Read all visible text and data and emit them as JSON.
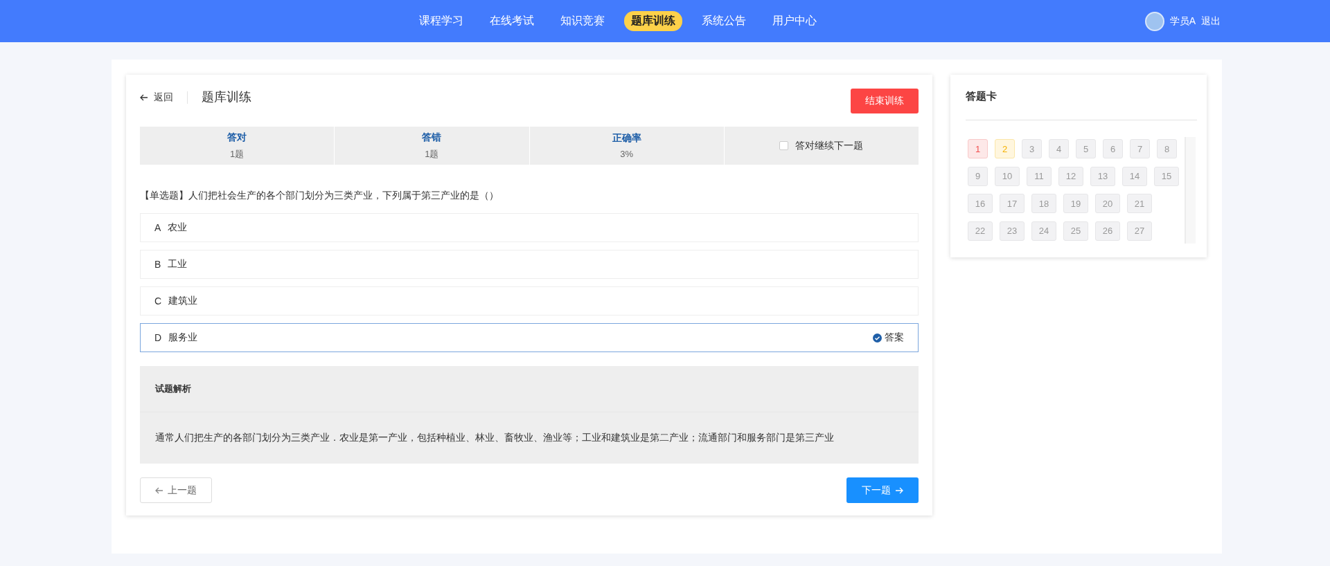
{
  "nav": {
    "items": [
      {
        "label": "课程学习",
        "selected": false
      },
      {
        "label": "在线考试",
        "selected": false
      },
      {
        "label": "知识竞赛",
        "selected": false
      },
      {
        "label": "题库训练",
        "selected": true
      },
      {
        "label": "系统公告",
        "selected": false
      },
      {
        "label": "用户中心",
        "selected": false
      }
    ],
    "user": "学员A",
    "logout": "退出"
  },
  "practice": {
    "back": "返回",
    "title": "题库训练",
    "end_button": "结束训练",
    "stats": [
      {
        "label": "答对",
        "value": "1题"
      },
      {
        "label": "答错",
        "value": "1题"
      },
      {
        "label": "正确率",
        "value": "3%"
      }
    ],
    "auto_next": {
      "label": "答对继续下一题",
      "checked": false
    },
    "question": "【单选题】人们把社会生产的各个部门划分为三类产业，下列属于第三产业的是（）",
    "options": [
      {
        "letter": "A",
        "text": "农业",
        "correct": false
      },
      {
        "letter": "B",
        "text": "工业",
        "correct": false
      },
      {
        "letter": "C",
        "text": "建筑业",
        "correct": false
      },
      {
        "letter": "D",
        "text": "服务业",
        "correct": true
      }
    ],
    "answer_tag": "答案",
    "analysis": {
      "title": "试题解析",
      "text": "通常人们把生产的各部门划分为三类产业．农业是第一产业，包括种植业、林业、畜牧业、渔业等；工业和建筑业是第二产业；流通部门和服务部门是第三产业"
    },
    "prev_button": "上一题",
    "next_button": "下一题"
  },
  "answer_card": {
    "title": "答题卡",
    "items": [
      {
        "label": "1",
        "kind": "wrong"
      },
      {
        "label": "2",
        "kind": "current"
      },
      {
        "label": "3"
      },
      {
        "label": "4"
      },
      {
        "label": "5"
      },
      {
        "label": "6"
      },
      {
        "label": "7"
      },
      {
        "label": "8"
      },
      {
        "label": "9"
      },
      {
        "label": "10"
      },
      {
        "label": "11"
      },
      {
        "label": "12"
      },
      {
        "label": "13"
      },
      {
        "label": "14"
      },
      {
        "label": "15"
      },
      {
        "label": "16"
      },
      {
        "label": "17"
      },
      {
        "label": "18"
      },
      {
        "label": "19"
      },
      {
        "label": "20"
      },
      {
        "label": "21"
      },
      {
        "label": "22"
      },
      {
        "label": "23"
      },
      {
        "label": "24"
      },
      {
        "label": "25"
      },
      {
        "label": "26"
      },
      {
        "label": "27"
      }
    ]
  }
}
